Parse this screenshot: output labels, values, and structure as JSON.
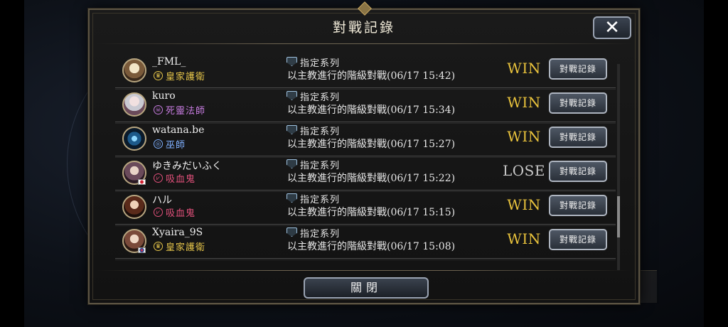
{
  "dialog": {
    "title": "對戰記錄",
    "close_icon": "close-icon",
    "close_button_label": "關閉"
  },
  "colors": {
    "win": "#e8c23c",
    "lose": "#c8c8c8",
    "royal_guard": "#e7c64a",
    "necromancer": "#c77ce0",
    "mage": "#7fb0ff",
    "vampire": "#e0507a"
  },
  "rows": [
    {
      "name": "_FML_",
      "class_label": "皇家護衛",
      "class_key": "royal_guard",
      "class_icon": "crown-icon",
      "mode": "指定系列",
      "desc": "以主教進行的階級對戰(06/17 15:42)",
      "result": "WIN",
      "button": "對戰記錄",
      "flag": ""
    },
    {
      "name": "kuro",
      "class_label": "死靈法師",
      "class_key": "necromancer",
      "class_icon": "skull-icon",
      "mode": "指定系列",
      "desc": "以主教進行的階級對戰(06/17 15:34)",
      "result": "WIN",
      "button": "對戰記錄",
      "flag": ""
    },
    {
      "name": "watana.be",
      "class_label": "巫師",
      "class_key": "mage",
      "class_icon": "sigil-icon",
      "mode": "指定系列",
      "desc": "以主教進行的階級對戰(06/17 15:27)",
      "result": "WIN",
      "button": "對戰記錄",
      "flag": ""
    },
    {
      "name": "ゆきみだいふく",
      "class_label": "吸血鬼",
      "class_key": "vampire",
      "class_icon": "fang-icon",
      "mode": "指定系列",
      "desc": "以主教進行的階級對戰(06/17 15:22)",
      "result": "LOSE",
      "button": "對戰記錄",
      "flag": "jp"
    },
    {
      "name": "ハル",
      "class_label": "吸血鬼",
      "class_key": "vampire",
      "class_icon": "fang-icon",
      "mode": "指定系列",
      "desc": "以主教進行的階級對戰(06/17 15:15)",
      "result": "WIN",
      "button": "對戰記錄",
      "flag": ""
    },
    {
      "name": "Xyaira_9S",
      "class_label": "皇家護衛",
      "class_key": "royal_guard",
      "class_icon": "crown-icon",
      "mode": "指定系列",
      "desc": "以主教進行的階級對戰(06/17 15:08)",
      "result": "WIN",
      "button": "對戰記錄",
      "flag": "kr"
    }
  ],
  "scroll": {
    "position": 0.8
  }
}
